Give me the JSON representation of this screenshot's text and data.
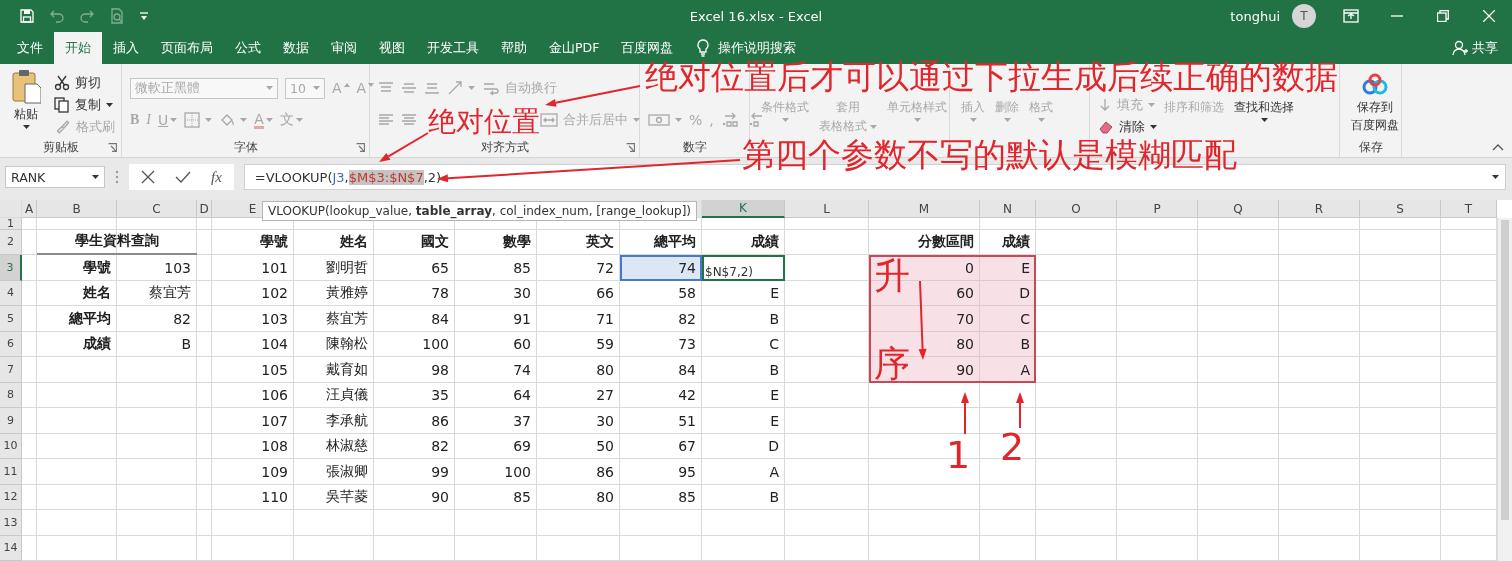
{
  "window": {
    "title": "Excel 16.xlsx - Excel",
    "user": "tonghui",
    "avatar": "T"
  },
  "quick_access": [
    {
      "kind": "save",
      "disabled": false
    },
    {
      "kind": "undo",
      "disabled": true
    },
    {
      "kind": "redo",
      "disabled": true
    },
    {
      "kind": "preview",
      "disabled": true
    },
    {
      "kind": "customize",
      "disabled": false
    }
  ],
  "menu": {
    "tabs": [
      {
        "label": "文件",
        "selected": false
      },
      {
        "label": "开始",
        "selected": true
      },
      {
        "label": "插入",
        "selected": false
      },
      {
        "label": "页面布局",
        "selected": false
      },
      {
        "label": "公式",
        "selected": false
      },
      {
        "label": "数据",
        "selected": false
      },
      {
        "label": "审阅",
        "selected": false
      },
      {
        "label": "视图",
        "selected": false
      },
      {
        "label": "开发工具",
        "selected": false
      },
      {
        "label": "帮助",
        "selected": false
      },
      {
        "label": "金山PDF",
        "selected": false
      },
      {
        "label": "百度网盘",
        "selected": false
      }
    ],
    "search": "操作说明搜索",
    "share": "共享"
  },
  "ribbon": {
    "groups": [
      {
        "label": "剪贴板",
        "launcher": true,
        "items": [
          {
            "kind": "paste",
            "text": "粘贴",
            "caret": true,
            "disabled": false
          },
          {
            "kind": "stack",
            "rows": [
              {
                "items": [
                  {
                    "kind": "cut",
                    "text": "剪切",
                    "disabled": false
                  }
                ]
              },
              {
                "items": [
                  {
                    "kind": "copy",
                    "text": "复制",
                    "caret": true,
                    "disabled": false
                  }
                ]
              },
              {
                "items": [
                  {
                    "kind": "brush",
                    "text": "格式刷",
                    "disabled": true
                  }
                ]
              }
            ]
          }
        ]
      },
      {
        "label": "字体",
        "launcher": true,
        "items": [
          {
            "kind": "stack",
            "rows": [
              {
                "items": [
                  {
                    "kind": "font-field",
                    "text": "微軟正黑體",
                    "disabled": true
                  },
                  {
                    "kind": "size-field",
                    "text": "10",
                    "disabled": true
                  },
                  {
                    "kind": "grow",
                    "text": "A",
                    "disabled": true
                  },
                  {
                    "kind": "shrink",
                    "text": "A",
                    "disabled": true
                  }
                ]
              },
              {
                "items": [
                  {
                    "kind": "bold",
                    "text": "B",
                    "disabled": true
                  },
                  {
                    "kind": "italic",
                    "text": "I",
                    "disabled": true
                  },
                  {
                    "kind": "underline",
                    "text": "U",
                    "caret": true,
                    "disabled": true
                  },
                  {
                    "kind": "borders",
                    "caret": true,
                    "disabled": true
                  },
                  {
                    "kind": "fill-color",
                    "caret": true,
                    "disabled": true
                  },
                  {
                    "kind": "font-color",
                    "text": "A",
                    "caret": true,
                    "disabled": true
                  },
                  {
                    "kind": "phonetic",
                    "text": "文",
                    "caret": true,
                    "disabled": true
                  }
                ]
              }
            ]
          }
        ]
      },
      {
        "label": "对齐方式",
        "launcher": true,
        "items": [
          {
            "kind": "stack",
            "rows": [
              {
                "items": [
                  {
                    "kind": "align-top",
                    "disabled": true
                  },
                  {
                    "kind": "align-middle",
                    "disabled": true
                  },
                  {
                    "kind": "align-bottom",
                    "disabled": true
                  },
                  {
                    "kind": "orientation",
                    "caret": true,
                    "disabled": true
                  },
                  {
                    "kind": "wrap",
                    "text": "自动换行",
                    "disabled": true
                  }
                ]
              },
              {
                "items": [
                  {
                    "kind": "align-left",
                    "disabled": true
                  },
                  {
                    "kind": "align-center",
                    "disabled": true
                  },
                  {
                    "kind": "merge",
                    "text": "合并后居中",
                    "caret": true,
                    "disabled": true
                  }
                ]
              }
            ]
          }
        ]
      },
      {
        "label": "数字",
        "items": [
          {
            "kind": "stack",
            "rows": [
              {
                "items": [
                  {
                    "kind": "currency",
                    "caret": true,
                    "disabled": true
                  },
                  {
                    "kind": "percent",
                    "text": "%",
                    "disabled": true
                  },
                  {
                    "kind": "comma",
                    "text": ",",
                    "disabled": true
                  },
                  {
                    "kind": "decimal-more",
                    "disabled": true
                  },
                  {
                    "kind": "decimal-less",
                    "disabled": true
                  }
                ]
              }
            ]
          }
        ]
      },
      {
        "items": [
          {
            "kind": "text-button",
            "lines": [
              "条件格式"
            ],
            "caret": true,
            "disabled": true
          },
          {
            "kind": "text-button",
            "lines": [
              "套用",
              "表格格式"
            ],
            "caret": true,
            "disabled": true
          },
          {
            "kind": "text-button",
            "lines": [
              "单元格样式"
            ],
            "caret": true,
            "disabled": true
          }
        ]
      },
      {
        "items": [
          {
            "kind": "text-button",
            "lines": [
              "插入"
            ],
            "caret": true,
            "disabled": true
          },
          {
            "kind": "text-button",
            "lines": [
              "删除"
            ],
            "caret": true,
            "disabled": true
          },
          {
            "kind": "text-button",
            "lines": [
              "格式"
            ],
            "caret": true,
            "disabled": true
          }
        ]
      },
      {
        "items": [
          {
            "kind": "stack",
            "rows": [
              {
                "items": [
                  {
                    "kind": "fill-down",
                    "text": "填充",
                    "caret": true,
                    "disabled": true
                  }
                ]
              },
              {
                "items": [
                  {
                    "kind": "clear",
                    "text": "清除",
                    "caret": true,
                    "disabled": false
                  }
                ]
              }
            ]
          },
          {
            "kind": "text-button",
            "lines": [
              "排序和筛选"
            ],
            "caret": false,
            "disabled": true
          },
          {
            "kind": "text-button",
            "lines": [
              "查找和选择"
            ],
            "caret": true,
            "disabled": false
          }
        ]
      },
      {
        "label": "保存",
        "items": [
          {
            "kind": "cloud",
            "lines": [
              "保存到",
              "百度网盘"
            ],
            "disabled": false
          }
        ]
      }
    ]
  },
  "formula_bar": {
    "name_box": "RANK",
    "function_label": "fx",
    "parts": [
      {
        "text": "=VLOOKUP(",
        "kind": "plain"
      },
      {
        "text": "J3",
        "kind": "cell_ref"
      },
      {
        "text": ",",
        "kind": "plain"
      },
      {
        "text": "$M$3:$N$7",
        "kind": "range_ref"
      },
      {
        "text": ",2)",
        "kind": "plain"
      }
    ]
  },
  "tooltip": "VLOOKUP(lookup_value, **table_array**, col_index_num, [range_lookup])",
  "sheet": {
    "column_headers": [
      {
        "label": "A",
        "selected": false
      },
      {
        "label": "B",
        "selected": false
      },
      {
        "label": "C",
        "selected": false
      },
      {
        "label": "D",
        "selected": false
      },
      {
        "label": "E",
        "selected": false
      }
    ],
    "column_headers_right": [
      {
        "label": "K",
        "selected": true
      },
      {
        "label": "L",
        "selected": false
      },
      {
        "label": "M",
        "selected": false
      },
      {
        "label": "N",
        "selected": false
      },
      {
        "label": "O",
        "selected": false
      },
      {
        "label": "P",
        "selected": false
      },
      {
        "label": "Q",
        "selected": false
      },
      {
        "label": "R",
        "selected": false
      },
      {
        "label": "S",
        "selected": false
      },
      {
        "label": "T",
        "selected": false
      }
    ],
    "row_headers": [
      {
        "label": "1",
        "selected": false
      },
      {
        "label": "2",
        "selected": false
      },
      {
        "label": "3",
        "selected": true
      },
      {
        "label": "4",
        "selected": false
      },
      {
        "label": "5",
        "selected": false
      },
      {
        "label": "6",
        "selected": false
      },
      {
        "label": "7",
        "selected": false
      },
      {
        "label": "8",
        "selected": false
      },
      {
        "label": "9",
        "selected": false
      },
      {
        "label": "10",
        "selected": false
      },
      {
        "label": "11",
        "selected": false
      },
      {
        "label": "12",
        "selected": false
      },
      {
        "label": "13",
        "selected": false
      },
      {
        "label": "14",
        "selected": false
      }
    ],
    "lookup_panel": {
      "title": "學生資料查詢",
      "rows": [
        {
          "label": "學號",
          "value": "103"
        },
        {
          "label": "姓名",
          "value": "蔡宜芳"
        },
        {
          "label": "總平均",
          "value": "82"
        },
        {
          "label": "成績",
          "value": "B"
        }
      ]
    },
    "students": {
      "columns": [
        "學號",
        "姓名",
        "國文",
        "數學",
        "英文",
        "總平均",
        "成績"
      ],
      "rows": [
        {
          "cells": [
            "101",
            "劉明哲",
            "65",
            "85",
            "72",
            "74"
          ],
          "average_referenced": true,
          "editing": true,
          "grade": "$N$7,2)"
        },
        {
          "cells": [
            "102",
            "黃雅婷",
            "78",
            "30",
            "66",
            "58"
          ],
          "average_referenced": false,
          "editing": false,
          "grade": "E"
        },
        {
          "cells": [
            "103",
            "蔡宜芳",
            "84",
            "91",
            "71",
            "82"
          ],
          "average_referenced": false,
          "editing": false,
          "grade": "B"
        },
        {
          "cells": [
            "104",
            "陳翰松",
            "100",
            "60",
            "59",
            "73"
          ],
          "average_referenced": false,
          "editing": false,
          "grade": "C"
        },
        {
          "cells": [
            "105",
            "戴育如",
            "98",
            "74",
            "80",
            "84"
          ],
          "average_referenced": false,
          "editing": false,
          "grade": "B"
        },
        {
          "cells": [
            "106",
            "汪貞儀",
            "35",
            "64",
            "27",
            "42"
          ],
          "average_referenced": false,
          "editing": false,
          "grade": "E"
        },
        {
          "cells": [
            "107",
            "李承航",
            "86",
            "37",
            "30",
            "51"
          ],
          "average_referenced": false,
          "editing": false,
          "grade": "E"
        },
        {
          "cells": [
            "108",
            "林淑慈",
            "82",
            "69",
            "50",
            "67"
          ],
          "average_referenced": false,
          "editing": false,
          "grade": "D"
        },
        {
          "cells": [
            "109",
            "張淑卿",
            "99",
            "100",
            "86",
            "95"
          ],
          "average_referenced": false,
          "editing": false,
          "grade": "A"
        },
        {
          "cells": [
            "110",
            "吳芊菱",
            "90",
            "85",
            "80",
            "85"
          ],
          "average_referenced": false,
          "editing": false,
          "grade": "B"
        }
      ]
    },
    "grade_table": {
      "columns": [
        "分數區間",
        "成績"
      ],
      "referenced": true,
      "rows": [
        [
          "0",
          "E"
        ],
        [
          "60",
          "D"
        ],
        [
          "70",
          "C"
        ],
        [
          "80",
          "B"
        ],
        [
          "90",
          "A"
        ]
      ]
    }
  },
  "annotations": [
    {
      "text": "绝对位置后才可以通过下拉生成后续正确的数据"
    },
    {
      "text": "绝对位置"
    },
    {
      "text": "第四个参数不写的默认是模糊匹配"
    },
    {
      "text": "升"
    },
    {
      "text": "序"
    },
    {
      "text": "1"
    },
    {
      "text": "2"
    }
  ]
}
